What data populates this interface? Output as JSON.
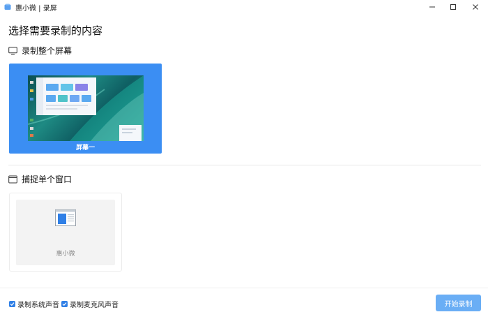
{
  "window": {
    "title": "惠小微 | 录屏",
    "minimize_icon": "minimize-icon",
    "maximize_icon": "maximize-icon",
    "close_icon": "close-icon"
  },
  "heading": "选择需要录制的内容",
  "full_screen": {
    "title": "录制整个屏幕",
    "icon": "monitor-icon",
    "screens": [
      {
        "label": "屏幕一",
        "selected": true
      }
    ]
  },
  "single_window": {
    "title": "捕捉单个窗口",
    "icon": "window-icon",
    "windows": [
      {
        "label": "惠小微"
      }
    ]
  },
  "footer": {
    "system_audio": {
      "label": "录制系统声音",
      "checked": true
    },
    "mic_audio": {
      "label": "录制麦克风声音",
      "checked": true
    },
    "start_button": "开始录制"
  },
  "colors": {
    "accent": "#3b8ef3",
    "button": "#6aaef5",
    "checkbox": "#2f7fe6"
  }
}
